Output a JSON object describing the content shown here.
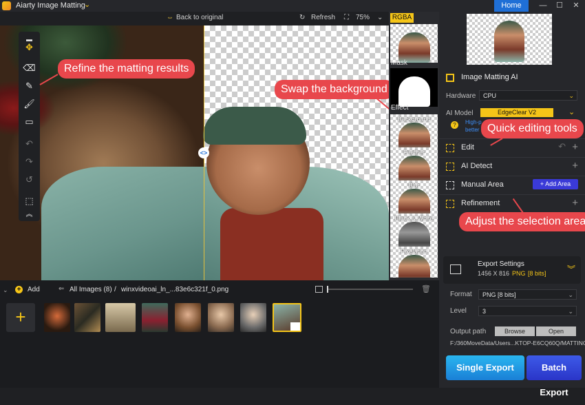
{
  "app": {
    "title": "Aiarty Image Matting",
    "home_label": "Home",
    "minimize": "—",
    "maximize": "☐",
    "close": "✕"
  },
  "toolbar": {
    "back_label": "Back to original",
    "refresh_label": "Refresh",
    "zoom_value": "75%"
  },
  "strip": {
    "rgba_label": "RGBA",
    "mask_label": "Mask",
    "effect_label": "Effect",
    "effects": [
      "Background",
      "Feather",
      "Blur",
      "Black & White",
      "Pixelation"
    ]
  },
  "callouts": {
    "refine": "Refine the matting results",
    "swap": "Swap the background",
    "quick": "Quick editing tools",
    "adjust": "Adjust the selection area"
  },
  "panel": {
    "section_title": "Image Matting AI",
    "hardware_label": "Hardware",
    "hardware_value": "CPU",
    "ai_model_label": "AI Model",
    "ai_model_value": "EdgeClear  V2",
    "ai_note_1": "High-p",
    "ai_note_2": "better",
    "edit_label": "Edit",
    "ai_detect_label": "AI Detect",
    "manual_area_label": "Manual Area",
    "add_area_label": "Add Area",
    "refinement_label": "Refinement",
    "export_settings_title": "Export Settings",
    "export_dims": "1456 X 816",
    "export_format_short": "PNG",
    "export_bits": "[8 bits]",
    "format_label": "Format",
    "format_value": "PNG   [8 bits]",
    "level_label": "Level",
    "level_value": "3",
    "output_path_label": "Output path",
    "browse_label": "Browse",
    "open_label": "Open",
    "output_path_value": "F:/360MoveData/Users...KTOP-E6CQ60Q/MATTING",
    "single_export_label": "Single Export",
    "batch_export_label": "Batch Export"
  },
  "bottom": {
    "add_label": "Add",
    "all_images_label": "All Images (8)",
    "separator": "/",
    "filename": "winxvideoai_ln_...83e6c321f_0.png"
  },
  "colors": {
    "accent": "#f5c518",
    "brand_blue": "#1f6fd6",
    "callout": "#e8474c"
  }
}
